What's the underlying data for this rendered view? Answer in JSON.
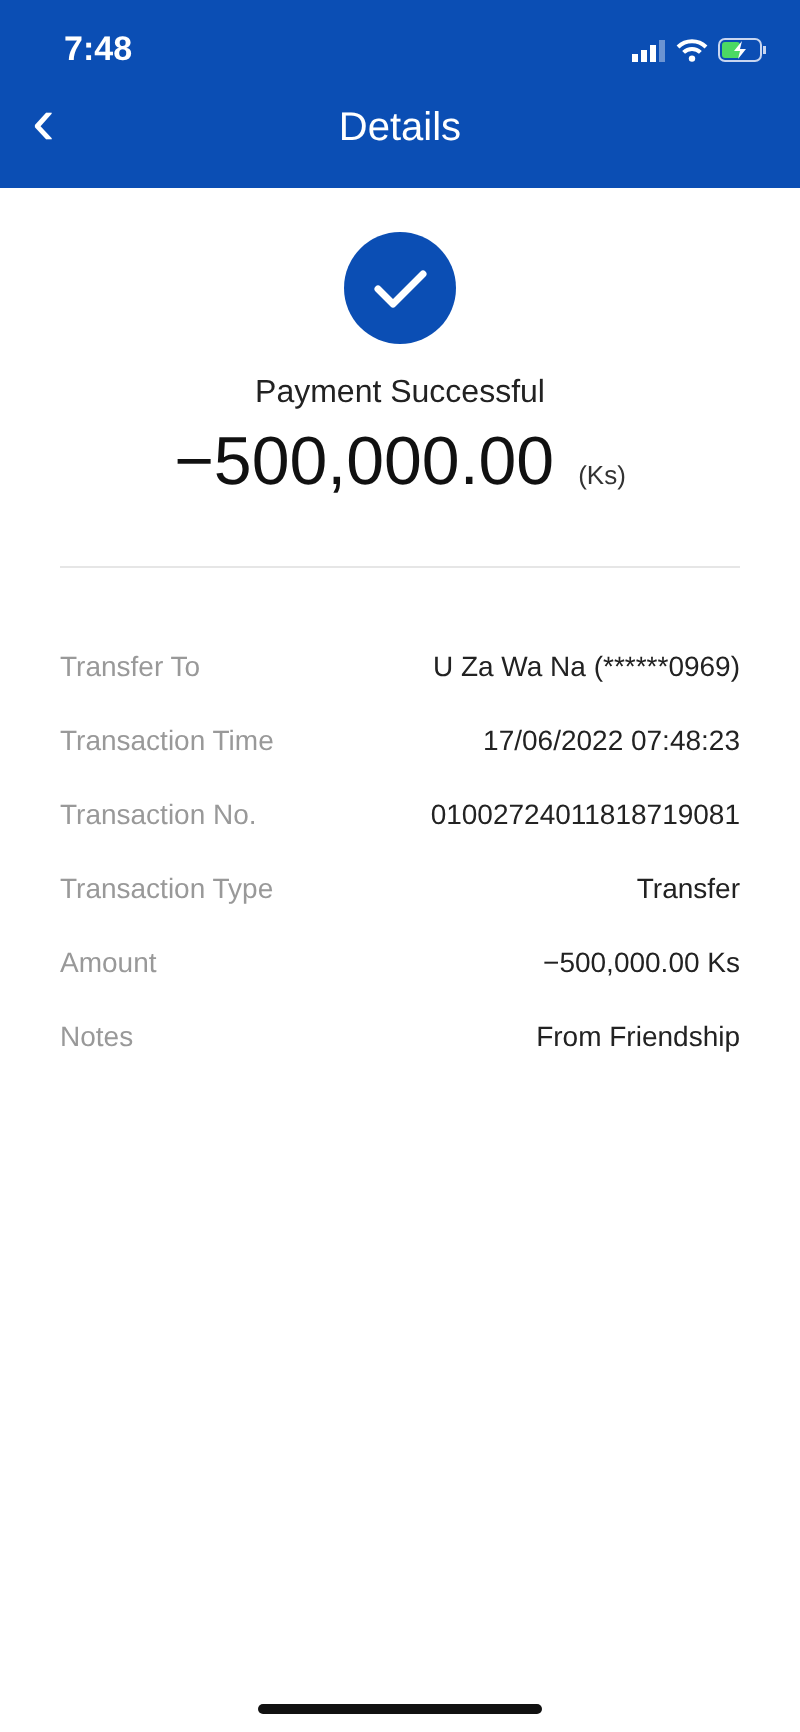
{
  "status_bar": {
    "time": "7:48"
  },
  "header": {
    "back": "‹",
    "title": "Details"
  },
  "result": {
    "status": "Payment Successful",
    "amount": "−500,000.00",
    "currency": "(Ks)"
  },
  "details": [
    {
      "label": "Transfer To",
      "value": "U Za Wa Na (******0969)"
    },
    {
      "label": "Transaction Time",
      "value": "17/06/2022 07:48:23"
    },
    {
      "label": "Transaction No.",
      "value": "01002724011818719081"
    },
    {
      "label": "Transaction Type",
      "value": "Transfer"
    },
    {
      "label": "Amount",
      "value": "−500,000.00 Ks"
    },
    {
      "label": "Notes",
      "value": "From Friendship"
    }
  ]
}
